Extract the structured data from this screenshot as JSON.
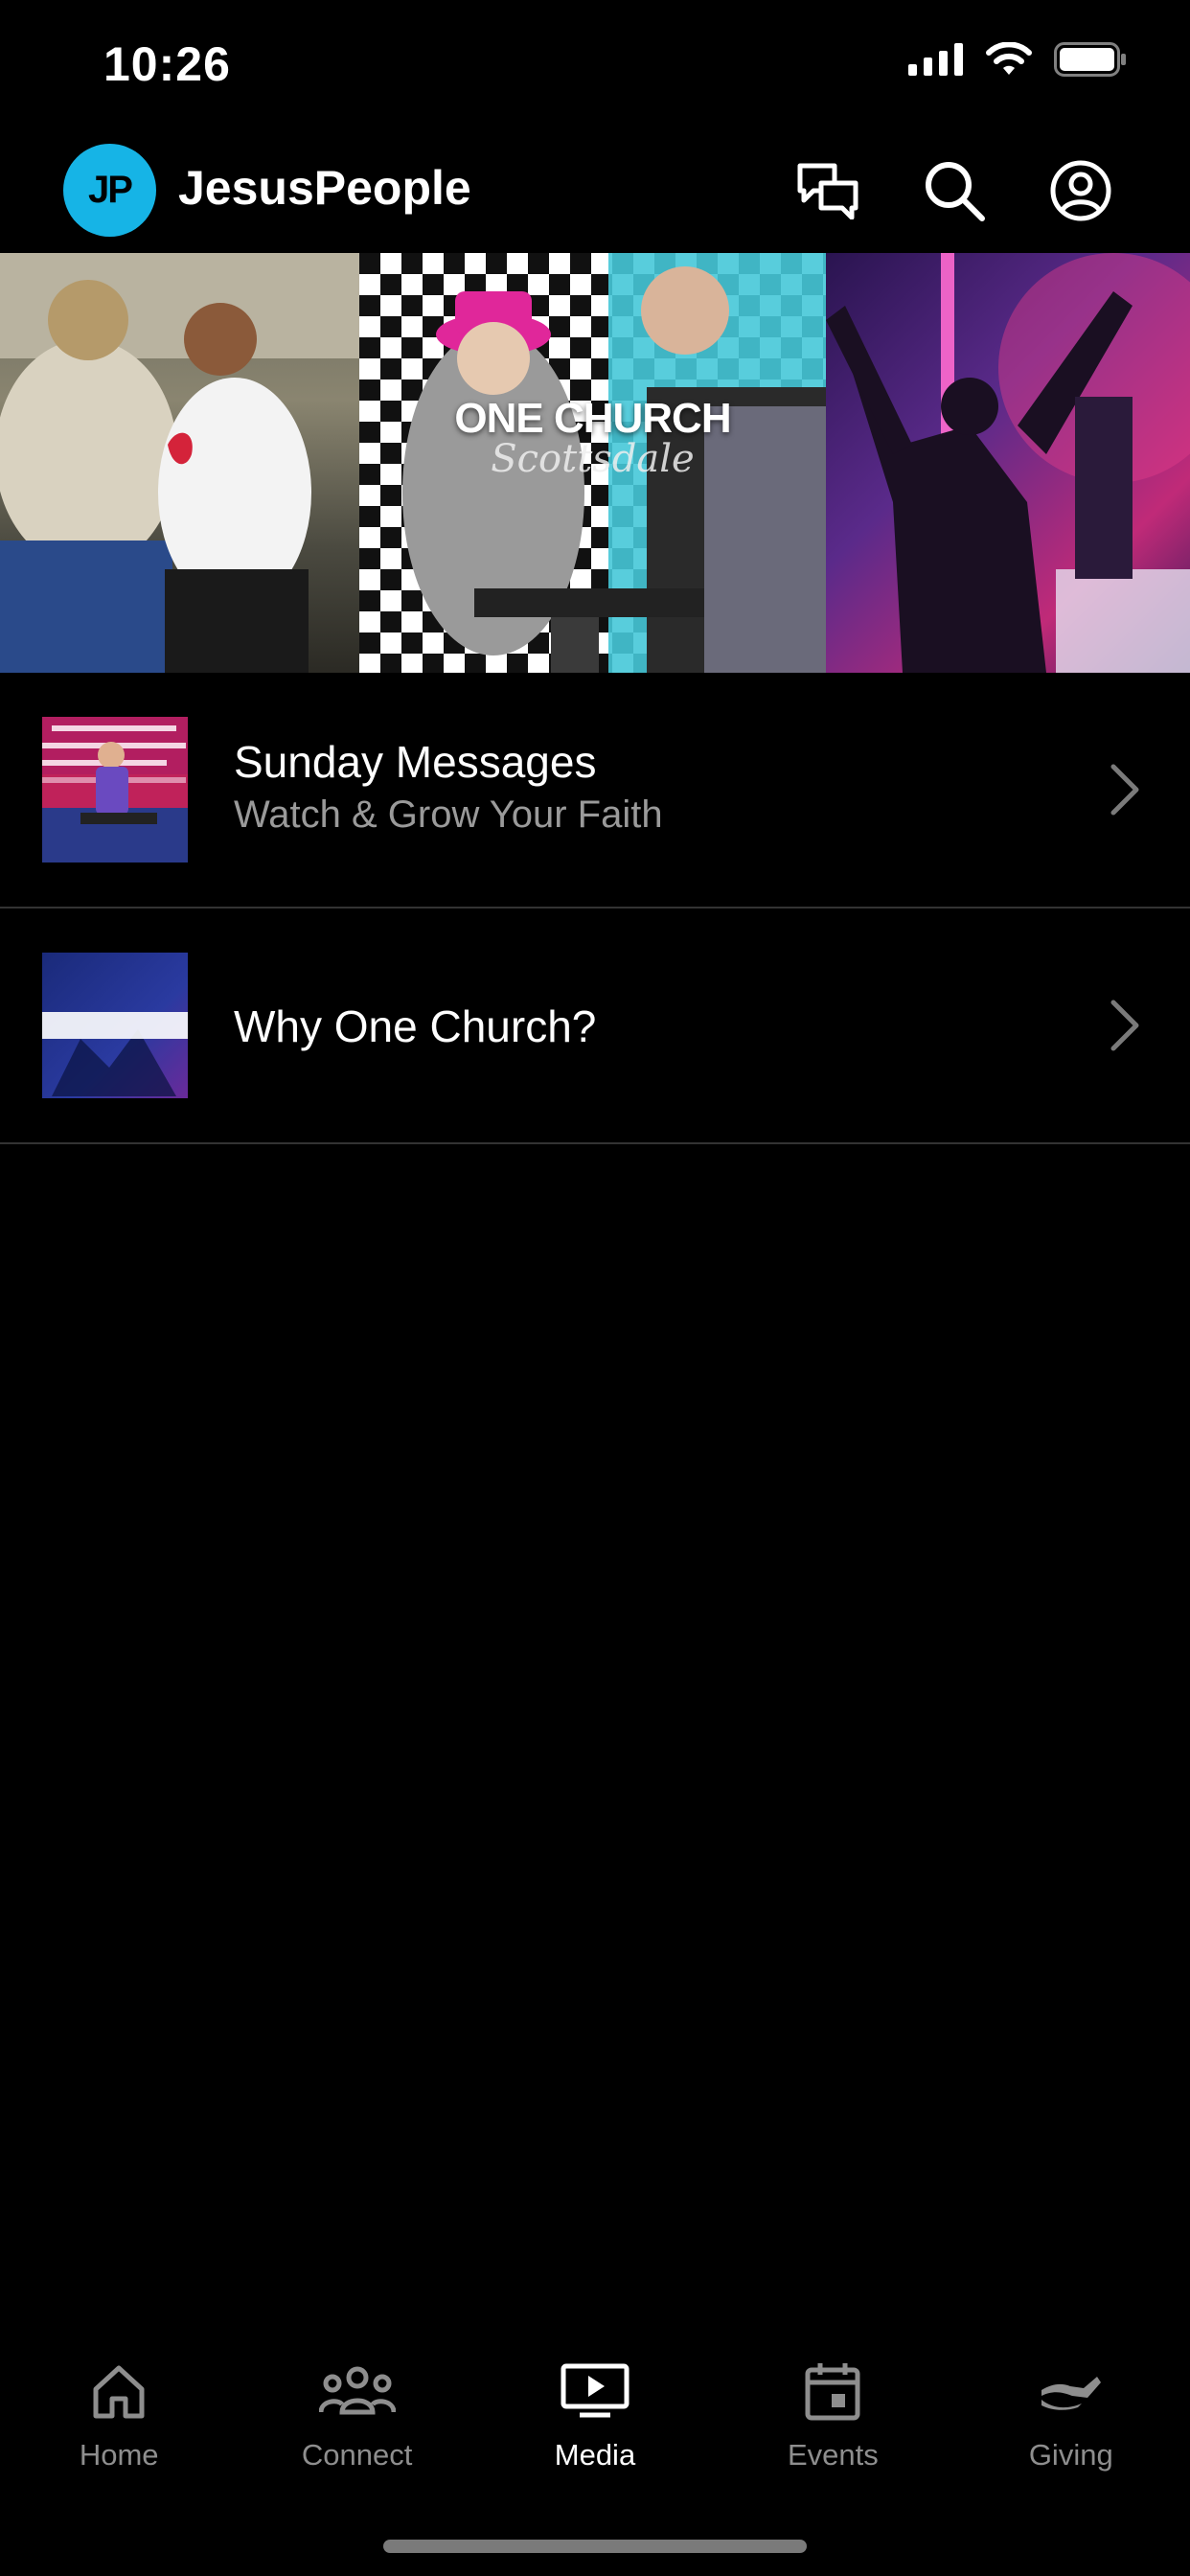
{
  "status_bar": {
    "time": "10:26"
  },
  "header": {
    "logo_text": "JP",
    "app_name": "JesusPeople",
    "icons": [
      "chat-icon",
      "search-icon",
      "profile-icon"
    ]
  },
  "hero": {
    "brand_title": "ONE CHURCH",
    "brand_script": "Scottsdale"
  },
  "media_list": [
    {
      "title": "Sunday Messages",
      "subtitle": "Watch & Grow Your Faith"
    },
    {
      "title": "Why One Church?",
      "subtitle": ""
    }
  ],
  "tabs": [
    {
      "label": "Home",
      "icon": "home-icon",
      "active": false
    },
    {
      "label": "Connect",
      "icon": "people-icon",
      "active": false
    },
    {
      "label": "Media",
      "icon": "play-screen-icon",
      "active": true
    },
    {
      "label": "Events",
      "icon": "calendar-icon",
      "active": false
    },
    {
      "label": "Giving",
      "icon": "giving-hand-icon",
      "active": false
    }
  ],
  "colors": {
    "accent": "#16b4e6",
    "background": "#000000",
    "muted": "#8e8e8e"
  }
}
